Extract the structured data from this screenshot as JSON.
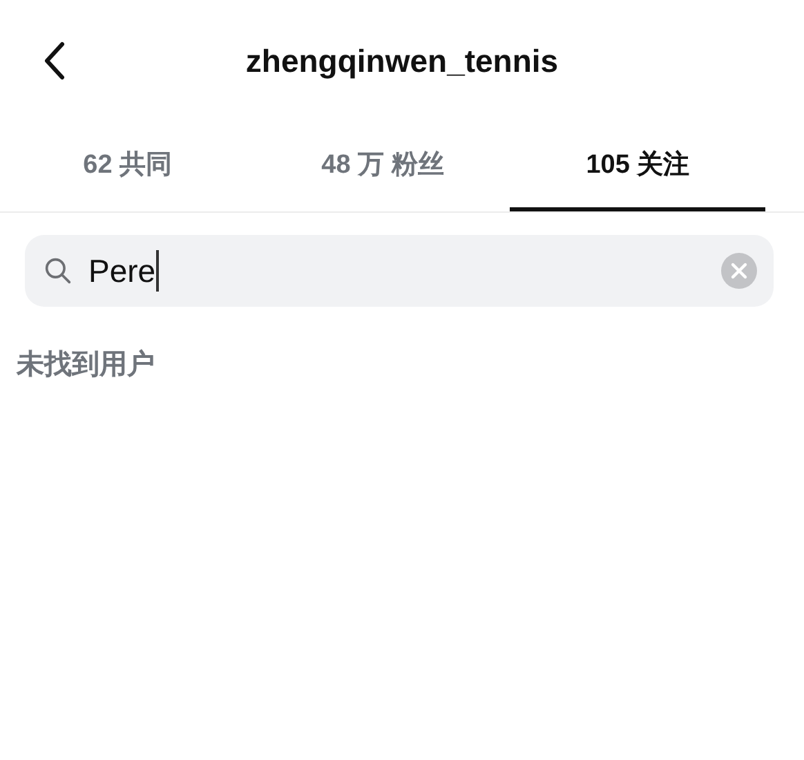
{
  "header": {
    "title": "zhengqinwen_tennis"
  },
  "tabs": [
    {
      "label": "62 共同",
      "selected": false
    },
    {
      "label": "48 万 粉丝",
      "selected": false
    },
    {
      "label": "105 关注",
      "selected": true
    }
  ],
  "search": {
    "value": "Pere"
  },
  "message": "未找到用户"
}
